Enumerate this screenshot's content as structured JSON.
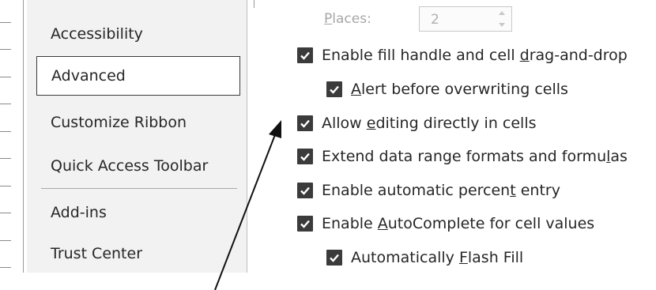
{
  "sidebar": {
    "items": [
      {
        "label": "Accessibility",
        "selected": false
      },
      {
        "label": "Advanced",
        "selected": true
      },
      {
        "label": "Customize Ribbon",
        "selected": false
      },
      {
        "label": "Quick Access Toolbar",
        "selected": false
      },
      {
        "label": "Add-ins",
        "selected": false
      },
      {
        "label": "Trust Center",
        "selected": false
      }
    ]
  },
  "places": {
    "label_pre": "",
    "label_accel": "P",
    "label_post": "laces:",
    "value": "2"
  },
  "options": [
    {
      "pre": "Enable fill handle and cell ",
      "accel": "d",
      "post": "rag-and-drop",
      "checked": true
    },
    {
      "pre": "",
      "accel": "A",
      "post": "lert before overwriting cells",
      "checked": true
    },
    {
      "pre": "Allow ",
      "accel": "e",
      "post": "diting directly in cells",
      "checked": true
    },
    {
      "pre": "Extend data range formats and formu",
      "accel": "l",
      "post": "as",
      "checked": true
    },
    {
      "pre": "Enable automatic percen",
      "accel": "t",
      "post": " entry",
      "checked": true
    },
    {
      "pre": "Enable ",
      "accel": "A",
      "post": "utoComplete for cell values",
      "checked": true
    },
    {
      "pre": "Automatically ",
      "accel": "F",
      "post": "lash Fill",
      "checked": true
    }
  ],
  "colors": {
    "checkbox": "#3b3b3b",
    "sidebar_bg": "#f2f2f2",
    "disabled_text": "#a6a6a6"
  },
  "icons": {
    "checkbox": "checkmark-icon",
    "spinner_up": "chevron-up-icon",
    "spinner_down": "chevron-down-icon",
    "annotation": "arrow-pointer-icon"
  }
}
